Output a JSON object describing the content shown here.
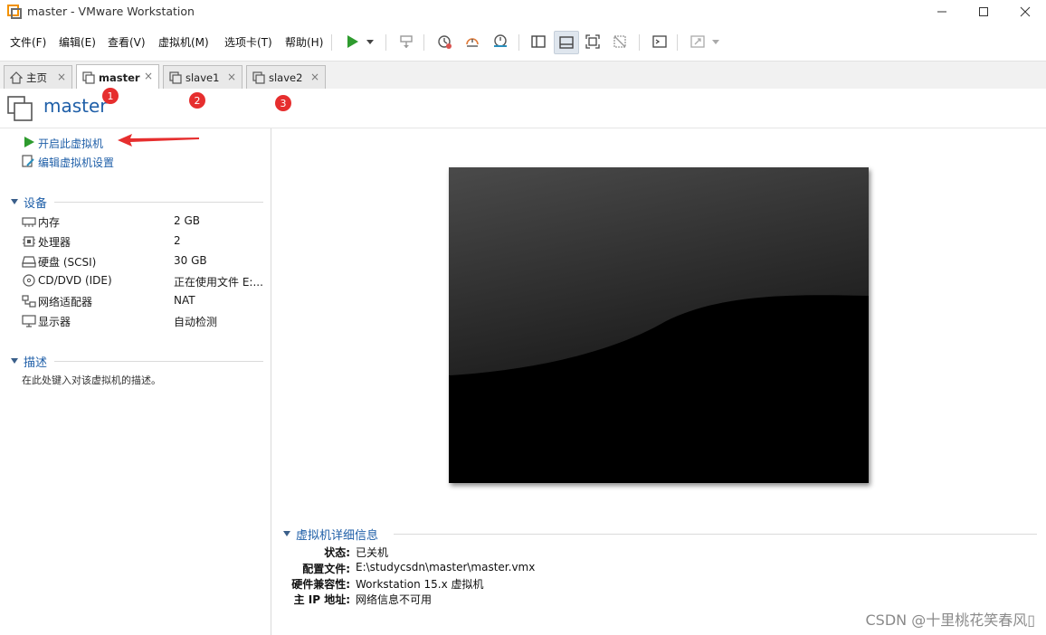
{
  "window": {
    "title": "master - VMware Workstation"
  },
  "menu": {
    "items": [
      "文件(F)",
      "编辑(E)",
      "查看(V)",
      "虚拟机(M)",
      "选项卡(T)",
      "帮助(H)"
    ]
  },
  "toolbar": {
    "icons": [
      "play-icon",
      "dropdown-icon",
      "send-keys-icon",
      "snapshot-icon",
      "revert-snapshot-icon",
      "snapshot-manager-icon",
      "show-library-icon",
      "thumbnail-bar-icon",
      "full-screen-icon",
      "unity-icon",
      "console-icon",
      "stretch-icon"
    ]
  },
  "tabs": [
    {
      "label": "主页",
      "close": "×"
    },
    {
      "label": "master",
      "close": "×"
    },
    {
      "label": "slave1",
      "close": "×"
    },
    {
      "label": "slave2",
      "close": "×"
    }
  ],
  "vm": {
    "title": "master"
  },
  "annotations": {
    "badges": [
      "1",
      "2",
      "3"
    ],
    "accent": "#e62e2e"
  },
  "actions": {
    "power_on": "开启此虚拟机",
    "edit_settings": "编辑虚拟机设置"
  },
  "devices": {
    "title": "设备",
    "items": [
      {
        "label": "内存",
        "value": "2 GB",
        "icon": "memory-icon"
      },
      {
        "label": "处理器",
        "value": "2",
        "icon": "cpu-icon"
      },
      {
        "label": "硬盘 (SCSI)",
        "value": "30 GB",
        "icon": "disk-icon"
      },
      {
        "label": "CD/DVD (IDE)",
        "value": "正在使用文件 E:...",
        "icon": "cd-icon"
      },
      {
        "label": "网络适配器",
        "value": "NAT",
        "icon": "network-icon"
      },
      {
        "label": "显示器",
        "value": "自动检测",
        "icon": "monitor-icon"
      }
    ]
  },
  "description": {
    "title": "描述",
    "placeholder": "在此处键入对该虚拟机的描述。"
  },
  "details": {
    "title": "虚拟机详细信息",
    "rows": [
      {
        "key": "状态:",
        "value": "已关机"
      },
      {
        "key": "配置文件:",
        "value": "E:\\studycsdn\\master\\master.vmx"
      },
      {
        "key": "硬件兼容性:",
        "value": "Workstation 15.x 虚拟机"
      },
      {
        "key": "主 IP 地址:",
        "value": "网络信息不可用"
      }
    ]
  },
  "watermark": "CSDN @十里桃花笑春风▯",
  "colors": {
    "link": "#1f5fa8",
    "play_green": "#2e9b2e",
    "badge_red": "#e62e2e"
  }
}
